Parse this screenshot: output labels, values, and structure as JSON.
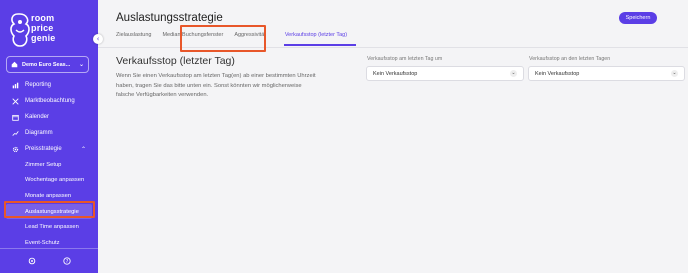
{
  "app": {
    "logo_lines": [
      "room",
      "price",
      "genie"
    ]
  },
  "sidebar": {
    "hotel_name": "Demo Euro Seas...",
    "items": [
      {
        "label": "Reporting",
        "icon": "bar-chart-icon"
      },
      {
        "label": "Marktbeobachtung",
        "icon": "telescope-icon"
      },
      {
        "label": "Kalender",
        "icon": "calendar-icon"
      },
      {
        "label": "Diagramm",
        "icon": "line-chart-icon"
      },
      {
        "label": "Preisstrategie",
        "icon": "gear-icon",
        "expanded": true
      }
    ],
    "subitems": [
      {
        "label": "Zimmer Setup"
      },
      {
        "label": "Wochentage anpassen"
      },
      {
        "label": "Monate anpassen"
      },
      {
        "label": "Auslastungsstrategie",
        "active": true
      },
      {
        "label": "Lead Time anpassen"
      },
      {
        "label": "Event-Schutz"
      }
    ],
    "footer_icons": [
      "settings-icon",
      "help-icon"
    ]
  },
  "header": {
    "title": "Auslastungsstrategie",
    "save_label": "Speichern",
    "tabs": [
      {
        "label": "Zielauslastung"
      },
      {
        "label": "Median Buchungsfenster"
      },
      {
        "label": "Aggressivität"
      },
      {
        "label": "Verkaufsstop (letzter Tag)",
        "active": true
      }
    ]
  },
  "content": {
    "title": "Verkaufsstop (letzter Tag)",
    "description": "Wenn Sie einen Verkaufsstop am letzten Tag(en) ab einer bestimmten Uhrzeit haben, tragen Sie das bitte unten ein. Sonst könnten wir möglicherweise falsche Verfügbarkeiten verwenden.",
    "field1": {
      "label": "Verkaufsstop am letzten Tag um",
      "value": "Kein Verkaufsstop"
    },
    "field2": {
      "label": "Verkaufsstop an den letzten Tagen",
      "value": "Kein Verkaufsstop"
    }
  },
  "colors": {
    "accent": "#5b3ee6",
    "highlight": "#e8572a",
    "background": "#f4f4f6"
  }
}
